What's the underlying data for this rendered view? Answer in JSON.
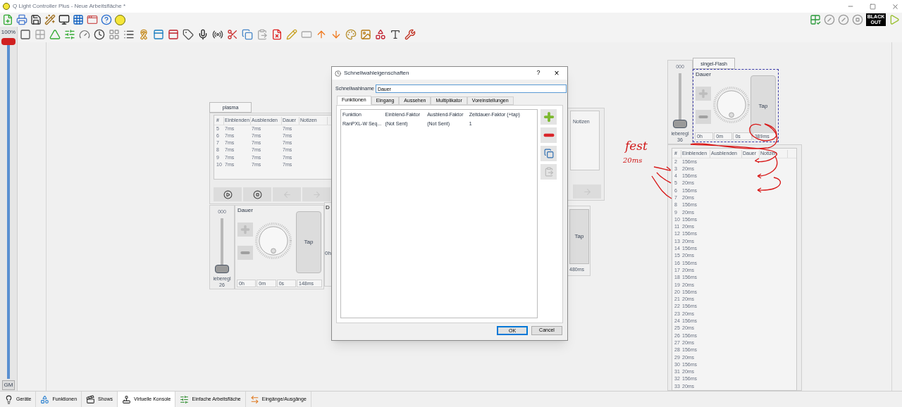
{
  "window": {
    "title": "Q Light Controller Plus - Neue Arbeitsfläche *",
    "blackout": "BLACK OUT"
  },
  "master": {
    "label": "100%",
    "footer": "GM",
    "level": 1
  },
  "plasma": {
    "tab": "plasma",
    "columns": [
      "#",
      "Einblenden",
      "Ausblenden",
      "Dauer",
      "Notizen"
    ],
    "rows": [
      [
        "5",
        "7ms",
        "7ms",
        "7ms"
      ],
      [
        "6",
        "7ms",
        "7ms",
        "7ms"
      ],
      [
        "7",
        "7ms",
        "7ms",
        "7ms"
      ],
      [
        "8",
        "7ms",
        "7ms",
        "7ms"
      ],
      [
        "9",
        "7ms",
        "7ms",
        "7ms"
      ],
      [
        "10",
        "7ms",
        "7ms",
        "7ms"
      ]
    ]
  },
  "left_dial": {
    "slider_value": "000",
    "slider_label": "ieberegl",
    "slider_number": "26",
    "level": 0,
    "title": "Dauer",
    "tap": "Tap",
    "fields": [
      "0h",
      "0m",
      "0s",
      "148ms"
    ],
    "next_title": "D",
    "next_field": "0h"
  },
  "middle_fragment": {
    "column": "Notizen",
    "tap": "Tap",
    "field": "480ms"
  },
  "right_dial": {
    "slider_value": "000",
    "slider_label": "ieberegl",
    "slider_number": "36",
    "level": 0,
    "tab": "singel-Flash",
    "title": "Dauer",
    "tap": "Tap",
    "fields": [
      "0h",
      "0m",
      "0s",
      "389ms"
    ],
    "selected": true
  },
  "right_cues": {
    "columns": [
      "#",
      "Einblenden",
      "Ausblenden",
      "Dauer",
      "Notizen"
    ],
    "rows": [
      [
        "2",
        "156ms"
      ],
      [
        "3",
        "20ms"
      ],
      [
        "4",
        "156ms"
      ],
      [
        "5",
        "20ms"
      ],
      [
        "6",
        "156ms"
      ],
      [
        "7",
        "20ms"
      ],
      [
        "8",
        "156ms"
      ],
      [
        "9",
        "20ms"
      ],
      [
        "10",
        "156ms"
      ],
      [
        "11",
        "20ms"
      ],
      [
        "12",
        "156ms"
      ],
      [
        "13",
        "20ms"
      ],
      [
        "14",
        "156ms"
      ],
      [
        "15",
        "20ms"
      ],
      [
        "16",
        "156ms"
      ],
      [
        "17",
        "20ms"
      ],
      [
        "18",
        "156ms"
      ],
      [
        "19",
        "20ms"
      ],
      [
        "20",
        "156ms"
      ],
      [
        "21",
        "20ms"
      ],
      [
        "22",
        "156ms"
      ],
      [
        "23",
        "20ms"
      ],
      [
        "24",
        "156ms"
      ],
      [
        "25",
        "20ms"
      ],
      [
        "26",
        "156ms"
      ],
      [
        "27",
        "20ms"
      ],
      [
        "28",
        "156ms"
      ],
      [
        "29",
        "20ms"
      ],
      [
        "30",
        "156ms"
      ],
      [
        "31",
        "20ms"
      ],
      [
        "32",
        "156ms"
      ],
      [
        "33",
        "20ms"
      ]
    ]
  },
  "annotation": {
    "word": "fest",
    "value": "20ms"
  },
  "dialog": {
    "title": "Schnellwahleigenschaften",
    "help": "?",
    "close": "×",
    "name_label": "Schnellwahlname",
    "name_value": "Dauer",
    "tabs": [
      {
        "label": "Funktionen",
        "selected": true
      },
      {
        "label": "Eingang",
        "selected": false
      },
      {
        "label": "Aussehen",
        "selected": false
      },
      {
        "label": "Multiplikator",
        "selected": false
      },
      {
        "label": "Voreinstellungen",
        "selected": false
      }
    ],
    "columns": [
      "Funktion",
      "Einblend-Faktor",
      "Ausblend-Faktor",
      "Zeitdauer-Faktor (+tap)"
    ],
    "rows": [
      [
        "RanPXL-W Seq...",
        "(Not Sent)",
        "(Not Sent)",
        "1"
      ]
    ],
    "buttons": [
      {
        "label": "OK",
        "default": true
      },
      {
        "label": "Cancel",
        "default": false
      }
    ]
  },
  "bottom_tabs": [
    {
      "label": "Geräte",
      "selected": false
    },
    {
      "label": "Funktionen",
      "selected": false
    },
    {
      "label": "Shows",
      "selected": false
    },
    {
      "label": "Virtuelle Konsole",
      "selected": true
    },
    {
      "label": "Einfache Arbeitsfläche",
      "selected": false
    },
    {
      "label": "Eingänge/Ausgänge",
      "selected": false
    }
  ]
}
